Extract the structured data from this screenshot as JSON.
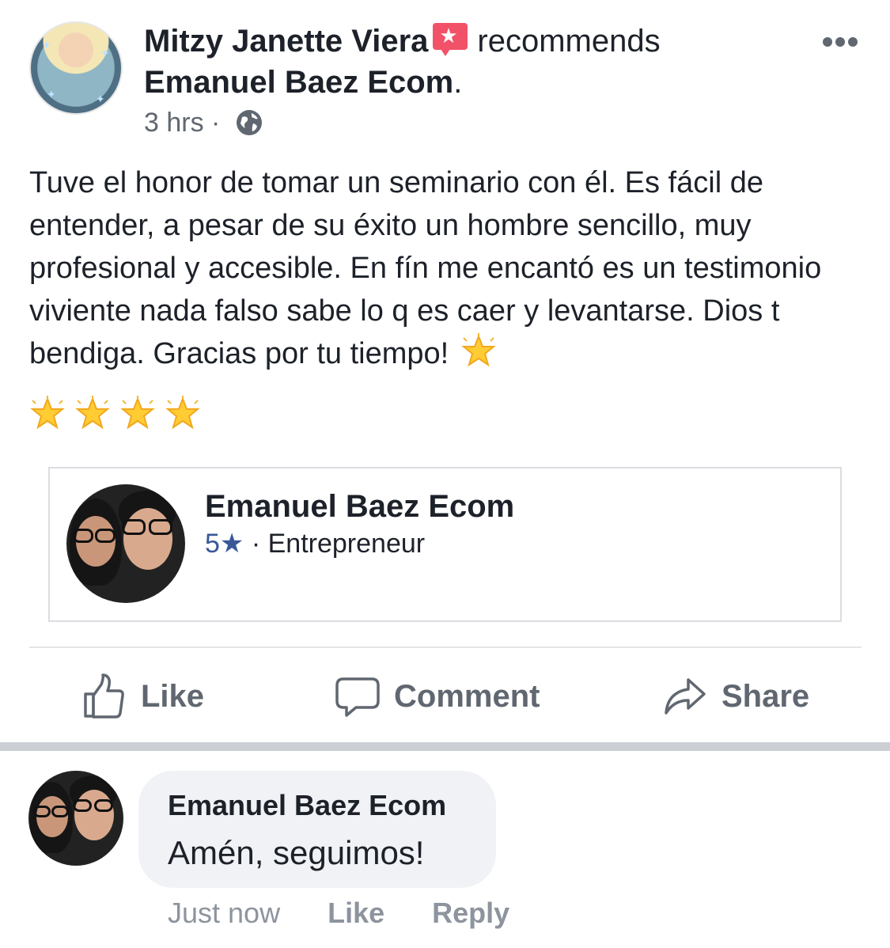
{
  "post": {
    "author": "Mitzy Janette Viera",
    "action": "recommends",
    "page_name": "Emanuel Baez Ecom",
    "page_name_suffix": ".",
    "time": "3 hrs",
    "separator": "·",
    "privacy_icon": "globe-icon",
    "recommend_icon": "recommendation-star-icon",
    "text": "Tuve el honor de tomar un seminario con él. Es fácil de entender, a pesar de su éxito un hombre sencillo, muy profesional y accesible. En fín me encantó es un testimonio viviente nada falso sabe lo q es caer y levantarse. Dios t bendiga. Gracias por tu tiempo!",
    "emoji": "glowing-star-emoji",
    "emoji_count_inline": 1,
    "emoji_count_row": 4
  },
  "card": {
    "title": "Emanuel Baez Ecom",
    "rating": "5★",
    "separator": "·",
    "category": "Entrepreneur"
  },
  "actions": {
    "like": "Like",
    "comment": "Comment",
    "share": "Share"
  },
  "comment": {
    "author": "Emanuel Baez Ecom",
    "text": "Amén, seguimos!",
    "time": "Just now",
    "like": "Like",
    "reply": "Reply"
  },
  "colors": {
    "text_primary": "#1d2129",
    "text_secondary": "#606770",
    "link_blue": "#385898",
    "recommend_red": "#f25268",
    "comment_bg": "#f0f2f5",
    "thick_divider": "#ccd0d5"
  }
}
